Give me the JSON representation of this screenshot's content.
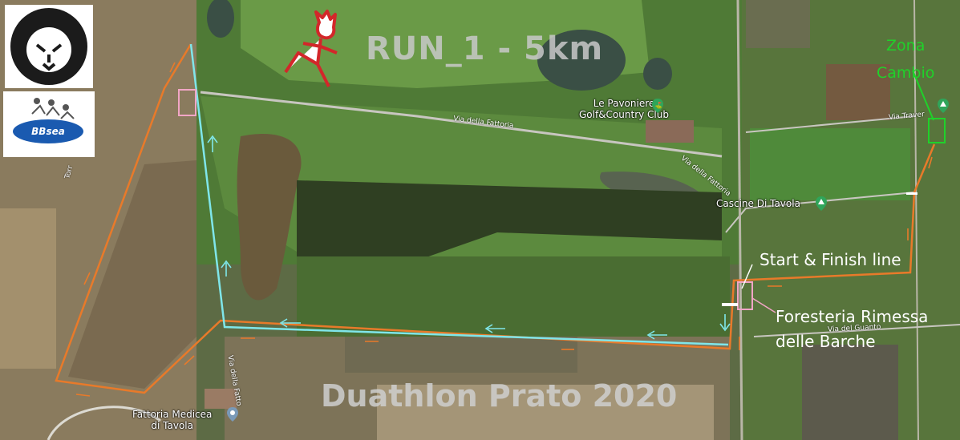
{
  "title": "RUN_1 - 5km",
  "footer": "Duathlon Prato 2020",
  "labels": {
    "zona_line1": "Zona",
    "zona_line2": "Cambio",
    "start_finish": "Start & Finish line",
    "foresteria_line1": "Foresteria Rimessa",
    "foresteria_line2": "delle Barche"
  },
  "pois": {
    "golf_line1": "Le Pavoniere",
    "golf_line2": "Golf&Country Club",
    "cascine": "Cascine Di Tavola",
    "fattoria_line1": "Fattoria Medicea",
    "fattoria_line2": "di Tavola"
  },
  "roads": {
    "fattoria": "Via della Fattoria",
    "fattoria2": "Via della Fattoria",
    "fatto_vert": "Via della Fatto",
    "guanto": "Via del Guanto",
    "traver": "Via Traver",
    "torr": "Torr"
  },
  "logos": {
    "bbsea_text": "BBsea"
  },
  "colors": {
    "run_route": "#7fe6ea",
    "bike_route": "#e87a2a",
    "zona_cambio": "#1fd22a",
    "marker": "#f2a6c6"
  },
  "icons": [
    "lion-logo-icon",
    "bbsea-logo-icon",
    "runner-icon",
    "golf-pin-icon",
    "tree-pin-icon",
    "location-pin-icon",
    "arrow-icon"
  ]
}
